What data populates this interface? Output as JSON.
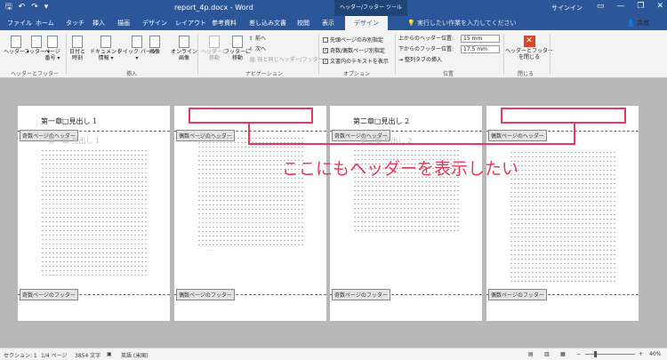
{
  "app": {
    "title": "report_4p.docx - Word",
    "context_group": "ヘッダー/フッター ツール",
    "sign_in": "サインイン",
    "share": "共有",
    "tell_me": "実行したい作業を入力してください"
  },
  "icons": {
    "save": "save-icon",
    "undo": "undo-icon",
    "redo": "redo-icon"
  },
  "tabs": [
    "ファイル",
    "ホーム",
    "タッチ",
    "挿入",
    "描画",
    "デザイン",
    "レイアウト",
    "参考資料",
    "差し込み文書",
    "校閲",
    "表示"
  ],
  "active_tab": "デザイン",
  "ribbon": {
    "hf": {
      "header": "ヘッダー",
      "footer": "フッター",
      "page_no_1": "ページ",
      "page_no_2": "番号",
      "group": "ヘッダーとフッター"
    },
    "insert": {
      "date_1": "日付と",
      "date_2": "時刻",
      "docinfo_1": "ドキュメント",
      "docinfo_2": "情報",
      "quick_1": "クイック",
      "quick_2": "パーツ",
      "picture": "画像",
      "online_1": "オンライン",
      "online_2": "画像",
      "group": "挿入"
    },
    "nav": {
      "goto_header_1": "ヘッダーに",
      "goto_header_2": "移動",
      "goto_footer_1": "フッターに",
      "goto_footer_2": "移動",
      "prev": "前へ",
      "next": "次へ",
      "link": "前と同じヘッダー/フッター",
      "group": "ナビゲーション"
    },
    "options": {
      "first": "先頭ページのみ別指定",
      "oddeven": "奇数/偶数ページ別指定",
      "showtext": "文書内のテキストを表示",
      "group": "オプション"
    },
    "position": {
      "header_pos": "上からのヘッダー位置:",
      "header_val": "15 mm",
      "footer_pos": "下からのフッター位置:",
      "footer_val": "17.5 mm",
      "align": "整列タブの挿入",
      "group": "位置"
    },
    "close": {
      "label_1": "ヘッダーとフッター",
      "label_2": "を閉じる",
      "group": "閉じる"
    }
  },
  "pages": [
    {
      "header_text": "第一章□見出し 1",
      "header_tag": "奇数ページのヘッダー",
      "footer_tag": "奇数ページのフッター",
      "ghost": "第一章 見出し 1"
    },
    {
      "header_text": "",
      "header_tag": "偶数ページのヘッダー",
      "footer_tag": "偶数ページのフッター",
      "ghost": ""
    },
    {
      "header_text": "第二章□見出し 2",
      "header_tag": "奇数ページのヘッダー",
      "footer_tag": "奇数ページのフッター",
      "ghost": "第二章 見出し 2"
    },
    {
      "header_text": "",
      "header_tag": "偶数ページのヘッダー",
      "footer_tag": "偶数ページのフッター",
      "ghost": ""
    }
  ],
  "annotation": {
    "text": "ここにもヘッダーを表示したい",
    "color": "#e8385e"
  },
  "status": {
    "section": "セクション: 1",
    "page": "1/4 ページ",
    "words": "3854 文字",
    "lang": "英語 (米国)",
    "zoom": "40%"
  },
  "colors": {
    "accent": "#2b579a",
    "annotation": "#e8385e"
  }
}
